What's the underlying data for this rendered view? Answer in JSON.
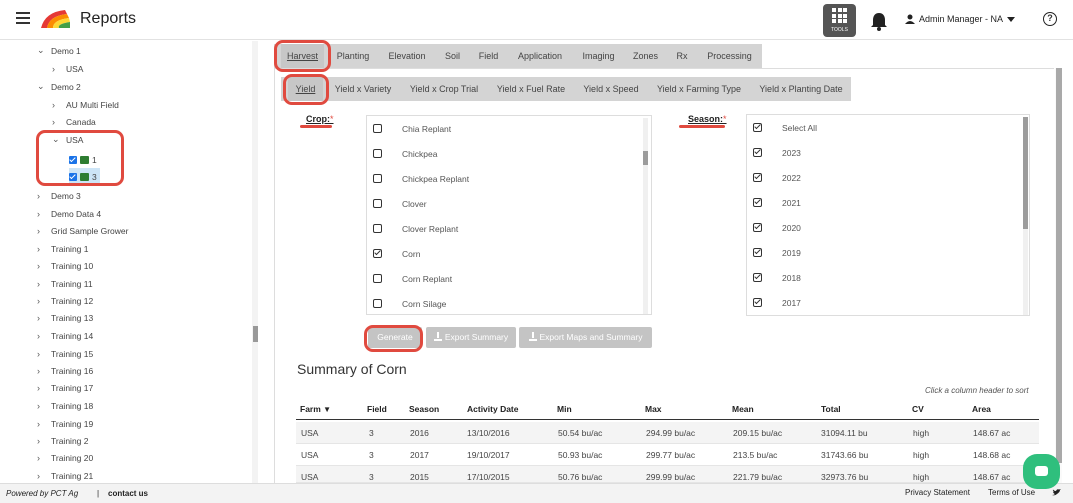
{
  "header": {
    "app_title": "Reports",
    "tools_label": "TOOLS",
    "user_name": "Admin Manager - NA",
    "help_label": "?"
  },
  "sidebar": {
    "rows": [
      {
        "label": "Demo 1",
        "chevron": "⌄"
      },
      {
        "label": "USA",
        "chevron": "›"
      },
      {
        "label": "Demo 2",
        "chevron": "⌄"
      },
      {
        "label": "AU Multi Field",
        "chevron": "›"
      },
      {
        "label": "Canada",
        "chevron": "›"
      },
      {
        "label": "USA",
        "chevron": "⌄"
      },
      {
        "label": "1",
        "chevron": ""
      },
      {
        "label": "3",
        "chevron": ""
      },
      {
        "label": "Demo 3",
        "chevron": "›"
      },
      {
        "label": "Demo Data 4",
        "chevron": "›"
      },
      {
        "label": "Grid Sample Grower",
        "chevron": "›"
      },
      {
        "label": "Training 1",
        "chevron": "›"
      },
      {
        "label": "Training 10",
        "chevron": "›"
      },
      {
        "label": "Training 11",
        "chevron": "›"
      },
      {
        "label": "Training 12",
        "chevron": "›"
      },
      {
        "label": "Training 13",
        "chevron": "›"
      },
      {
        "label": "Training 14",
        "chevron": "›"
      },
      {
        "label": "Training 15",
        "chevron": "›"
      },
      {
        "label": "Training 16",
        "chevron": "›"
      },
      {
        "label": "Training 17",
        "chevron": "›"
      },
      {
        "label": "Training 18",
        "chevron": "›"
      },
      {
        "label": "Training 19",
        "chevron": "›"
      },
      {
        "label": "Training 2",
        "chevron": "›"
      },
      {
        "label": "Training 20",
        "chevron": "›"
      },
      {
        "label": "Training 21",
        "chevron": "›"
      }
    ]
  },
  "tabs_primary": [
    "Harvest",
    "Planting",
    "Elevation",
    "Soil",
    "Field",
    "Application",
    "Imaging",
    "Zones",
    "Rx",
    "Processing"
  ],
  "tabs_secondary": [
    "Yield",
    "Yield x Variety",
    "Yield x Crop Trial",
    "Yield x Fuel Rate",
    "Yield x Speed",
    "Yield x Farming Type",
    "Yield x Planting Date"
  ],
  "crop": {
    "label": "Crop:",
    "required": "*",
    "items": [
      {
        "label": "Chia Replant",
        "checked": false
      },
      {
        "label": "Chickpea",
        "checked": false
      },
      {
        "label": "Chickpea Replant",
        "checked": false
      },
      {
        "label": "Clover",
        "checked": false
      },
      {
        "label": "Clover Replant",
        "checked": false
      },
      {
        "label": "Corn",
        "checked": true
      },
      {
        "label": "Corn Replant",
        "checked": false
      },
      {
        "label": "Corn Silage",
        "checked": false
      }
    ]
  },
  "season": {
    "label": "Season:",
    "required": "*",
    "items": [
      {
        "label": "Select All",
        "checked": true
      },
      {
        "label": "2023",
        "checked": true
      },
      {
        "label": "2022",
        "checked": true
      },
      {
        "label": "2021",
        "checked": true
      },
      {
        "label": "2020",
        "checked": true
      },
      {
        "label": "2019",
        "checked": true
      },
      {
        "label": "2018",
        "checked": true
      },
      {
        "label": "2017",
        "checked": true
      }
    ]
  },
  "buttons": {
    "generate": "Generate",
    "export_summary": "Export Summary",
    "export_maps": "Export Maps and Summary"
  },
  "summary": {
    "title": "Summary of Corn",
    "sort_hint": "Click a column header to sort",
    "columns": [
      "Farm",
      "Field",
      "Season",
      "Activity Date",
      "Min",
      "Max",
      "Mean",
      "Total",
      "CV",
      "Area"
    ],
    "rows": [
      [
        "USA",
        "3",
        "2016",
        "13/10/2016",
        "50.54 bu/ac",
        "294.99 bu/ac",
        "209.15 bu/ac",
        "31094.11 bu",
        "high",
        "148.67 ac"
      ],
      [
        "USA",
        "3",
        "2017",
        "19/10/2017",
        "50.93 bu/ac",
        "299.77 bu/ac",
        "213.5 bu/ac",
        "31743.66 bu",
        "high",
        "148.68 ac"
      ],
      [
        "USA",
        "3",
        "2015",
        "17/10/2015",
        "50.76 bu/ac",
        "299.99 bu/ac",
        "221.79 bu/ac",
        "32973.76 bu",
        "high",
        "148.67 ac"
      ]
    ]
  },
  "footer": {
    "powered_by": "Powered by PCT Ag",
    "separator": "|",
    "contact": "contact us",
    "privacy": "Privacy Statement",
    "terms": "Terms of Use"
  },
  "colors": {
    "highlight": "#e04a3f",
    "chat": "#2fbf7d"
  }
}
